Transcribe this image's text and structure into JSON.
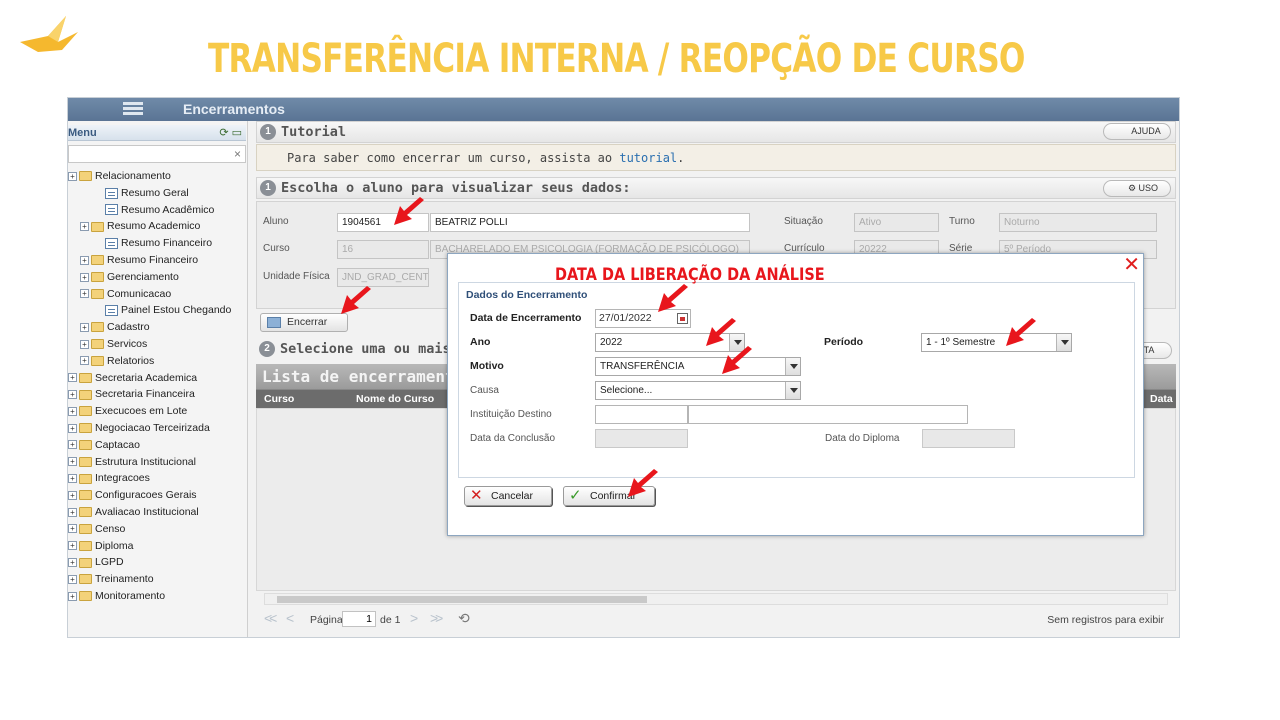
{
  "slide": {
    "title": "TRANSFERÊNCIA INTERNA / REOPÇÃO DE CURSO",
    "annotation": "DATA DA LIBERAÇÃO DA ANÁLISE"
  },
  "app": {
    "page_title": "Encerramentos"
  },
  "sidebar": {
    "menu_label": "Menu",
    "search_value": "",
    "items": [
      {
        "label": "Relacionamento",
        "level": 0,
        "type": "folder"
      },
      {
        "label": "Resumo Geral",
        "level": 2,
        "type": "doc"
      },
      {
        "label": "Resumo Acadêmico",
        "level": 2,
        "type": "doc"
      },
      {
        "label": "Resumo Academico",
        "level": 1,
        "type": "folder"
      },
      {
        "label": "Resumo Financeiro",
        "level": 2,
        "type": "doc"
      },
      {
        "label": "Resumo Financeiro",
        "level": 1,
        "type": "folder"
      },
      {
        "label": "Gerenciamento",
        "level": 1,
        "type": "folder"
      },
      {
        "label": "Comunicacao",
        "level": 1,
        "type": "folder"
      },
      {
        "label": "Painel Estou Chegando",
        "level": 2,
        "type": "doc"
      },
      {
        "label": "Cadastro",
        "level": 1,
        "type": "folder"
      },
      {
        "label": "Servicos",
        "level": 1,
        "type": "folder"
      },
      {
        "label": "Relatorios",
        "level": 1,
        "type": "folder"
      },
      {
        "label": "Secretaria Academica",
        "level": 0,
        "type": "folder"
      },
      {
        "label": "Secretaria Financeira",
        "level": 0,
        "type": "folder"
      },
      {
        "label": "Execucoes em Lote",
        "level": 0,
        "type": "folder"
      },
      {
        "label": "Negociacao Terceirizada",
        "level": 0,
        "type": "folder"
      },
      {
        "label": "Captacao",
        "level": 0,
        "type": "folder"
      },
      {
        "label": "Estrutura Institucional",
        "level": 0,
        "type": "folder"
      },
      {
        "label": "Integracoes",
        "level": 0,
        "type": "folder"
      },
      {
        "label": "Configuracoes Gerais",
        "level": 0,
        "type": "folder"
      },
      {
        "label": "Avaliacao Institucional",
        "level": 0,
        "type": "folder"
      },
      {
        "label": "Censo",
        "level": 0,
        "type": "folder"
      },
      {
        "label": "Diploma",
        "level": 0,
        "type": "folder"
      },
      {
        "label": "LGPD",
        "level": 0,
        "type": "folder"
      },
      {
        "label": "Treinamento",
        "level": 0,
        "type": "folder"
      },
      {
        "label": "Monitoramento",
        "level": 0,
        "type": "folder"
      }
    ]
  },
  "tutorial": {
    "number": "1",
    "title": "Tutorial",
    "help_label": "AJUDA",
    "text": "Para saber como encerrar um curso, assista ao",
    "link": "tutorial",
    "period": "."
  },
  "student": {
    "number": "1",
    "title": "Escolha o aluno para visualizar seus dados:",
    "uso_label": "USO",
    "aluno_label": "Aluno",
    "aluno_id": "1904561",
    "aluno_name": "BEATRIZ POLLI",
    "situacao_label": "Situação",
    "situacao_value": "Ativo",
    "turno_label": "Turno",
    "turno_value": "Noturno",
    "curso_label": "Curso",
    "curso_id": "16",
    "curso_name": "BACHARELADO EM PSICOLOGIA (FORMAÇÃO DE PSICÓLOGO)",
    "curriculo_label": "Currículo",
    "curriculo_value": "20222",
    "serie_label": "Série",
    "serie_value": "5º Período",
    "unidade_label": "Unidade Física",
    "unidade_value": "JND_GRAD_CENTR"
  },
  "actions": {
    "encerrar_label": "Encerrar"
  },
  "select_section": {
    "number": "2",
    "title": "Selecione uma ou mais e",
    "right_btn": "TA"
  },
  "list": {
    "title": "Lista de encerramentos",
    "columns": [
      "Curso",
      "Nome do Curso",
      "Data"
    ],
    "pager_label": "Página",
    "page": "1",
    "of_label": "de 1",
    "empty_text": "Sem registros para exibir"
  },
  "dialog": {
    "legend": "Dados do Encerramento",
    "data_encerramento_label": "Data de Encerramento",
    "data_encerramento_value": "27/01/2022",
    "ano_label": "Ano",
    "ano_value": "2022",
    "periodo_label": "Período",
    "periodo_value": "1 - 1º Semestre",
    "motivo_label": "Motivo",
    "motivo_value": "TRANSFERÊNCIA",
    "causa_label": "Causa",
    "causa_value": "Selecione...",
    "instituicao_label": "Instituição Destino",
    "instituicao_code": "",
    "instituicao_name": "",
    "conclusao_label": "Data da Conclusão",
    "conclusao_value": "",
    "diploma_label": "Data do Diploma",
    "diploma_value": "",
    "cancel_label": "Cancelar",
    "confirm_label": "Confirmar"
  },
  "colors": {
    "title_yellow": "#f7c948",
    "annotation_red": "#e8161c",
    "topbar": "#5a7494"
  }
}
